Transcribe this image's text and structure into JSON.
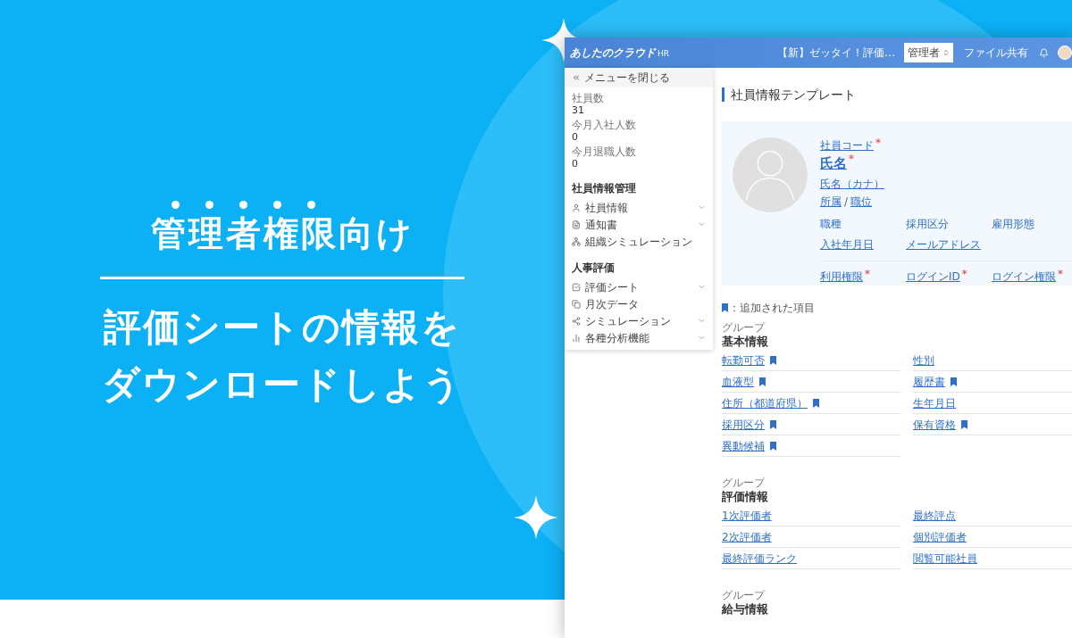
{
  "hero": {
    "title": "管理者権限向け",
    "subtitle": [
      "評価シートの情報を",
      "ダウンロードしよう"
    ]
  },
  "app": {
    "header": {
      "logo": "あしたのクラウド",
      "logo_badge": "HR",
      "notice": "【新】ゼッタイ！評価…",
      "role": "管理者",
      "link": "ファイル共有"
    },
    "sidebar": {
      "close": "メニューを閉じる",
      "stats": [
        {
          "label": "社員数",
          "value": "31"
        },
        {
          "label": "今月入社人数",
          "value": "0"
        },
        {
          "label": "今月退職人数",
          "value": "0"
        }
      ],
      "sections": [
        {
          "title": "社員情報管理",
          "items": [
            {
              "label": "社員情報",
              "expandable": true
            },
            {
              "label": "通知書",
              "expandable": true
            },
            {
              "label": "組織シミュレーション",
              "expandable": false
            }
          ]
        },
        {
          "title": "人事評価",
          "items": [
            {
              "label": "評価シート",
              "expandable": true
            },
            {
              "label": "月次データ",
              "expandable": false
            },
            {
              "label": "シミュレーション",
              "expandable": true
            },
            {
              "label": "各種分析機能",
              "expandable": true
            }
          ]
        }
      ]
    },
    "page_title": "社員情報テンプレート",
    "profile": {
      "code": {
        "label": "社員コード",
        "required": true
      },
      "name": {
        "label": "氏名",
        "required": true
      },
      "required_mark": "*",
      "kana": "氏名（カナ）",
      "department": "所属",
      "separator": "/",
      "position": "職位",
      "fields": [
        {
          "label": "職種",
          "link": false
        },
        {
          "label": "採用区分",
          "link": false
        },
        {
          "label": "雇用形態",
          "link": false
        },
        {
          "label": "入社年月日",
          "link": true
        },
        {
          "label": "メールアドレス",
          "link": true
        }
      ],
      "access": [
        {
          "label": "利用権限",
          "required": true
        },
        {
          "label": "ログインID",
          "required": true
        },
        {
          "label": "ログイン権限",
          "required": true
        }
      ]
    },
    "legend": "：追加された項目",
    "groups": [
      {
        "caption": "グループ",
        "title": "基本情報",
        "fields": [
          {
            "label": "転勤可否",
            "added": true
          },
          {
            "label": "性別",
            "added": false
          },
          {
            "label": "血液型",
            "added": true
          },
          {
            "label": "履歴書",
            "added": true
          },
          {
            "label": "住所（都道府県）",
            "added": true
          },
          {
            "label": "生年月日",
            "added": false
          },
          {
            "label": "採用区分",
            "added": true
          },
          {
            "label": "保有資格",
            "added": true
          },
          {
            "label": "異動候補",
            "added": true
          }
        ]
      },
      {
        "caption": "グループ",
        "title": "評価情報",
        "fields": [
          {
            "label": "1次評価者",
            "added": false
          },
          {
            "label": "最終評点",
            "added": false
          },
          {
            "label": "2次評価者",
            "added": false
          },
          {
            "label": "個別評価者",
            "added": false
          },
          {
            "label": "最終評価ランク",
            "added": false
          },
          {
            "label": "閲覧可能社員",
            "added": false
          }
        ]
      },
      {
        "caption": "グループ",
        "title": "給与情報"
      }
    ]
  }
}
